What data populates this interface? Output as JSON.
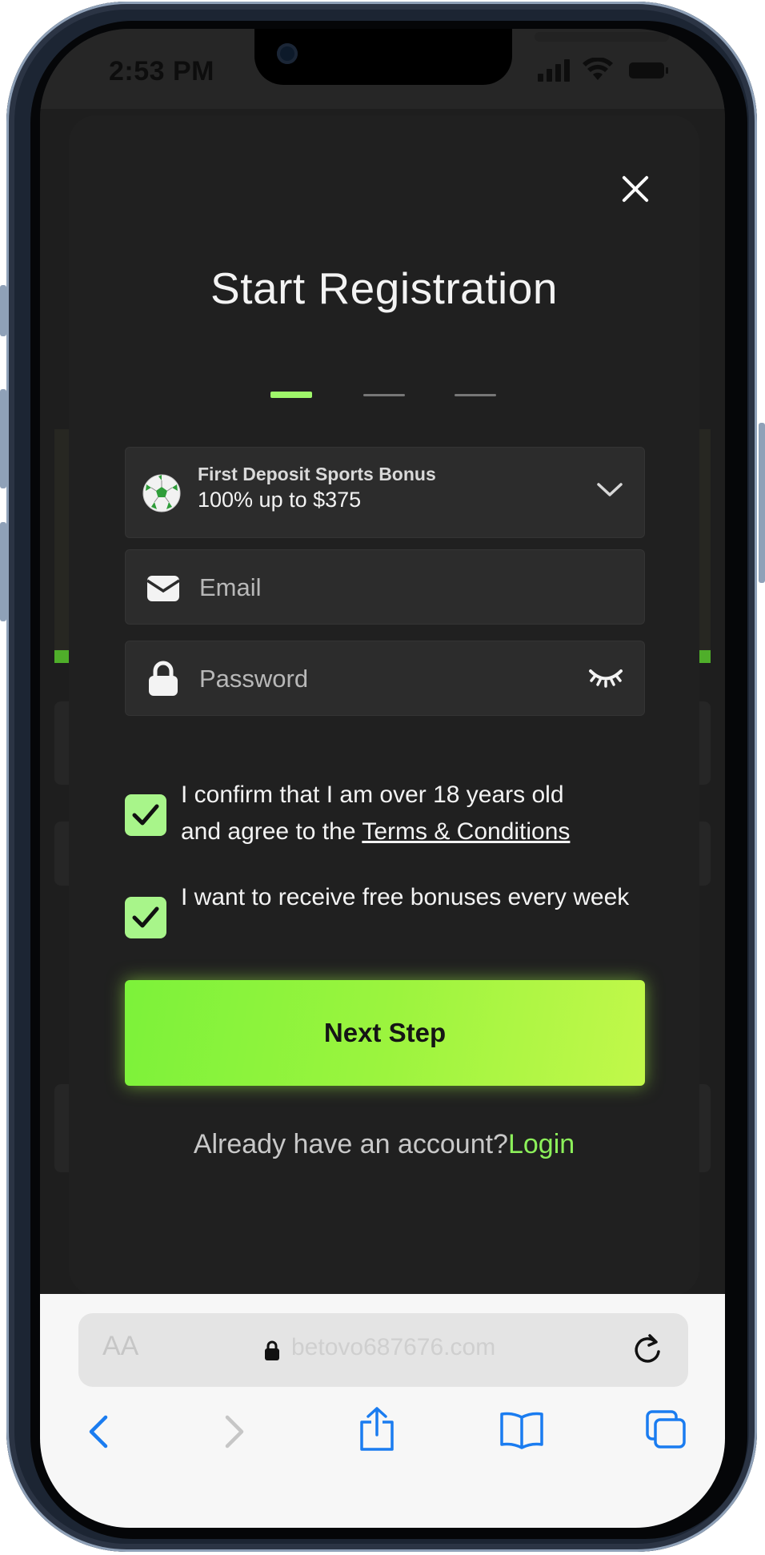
{
  "status_bar": {
    "time": "2:53 PM",
    "icons": [
      "cellular-signal-icon",
      "wifi-icon",
      "battery-icon"
    ]
  },
  "modal": {
    "title": "Start Registration",
    "close_icon": "close-icon",
    "steps": {
      "total": 3,
      "current": 1
    },
    "bonus": {
      "icon": "soccer-ball-icon",
      "title": "First Deposit Sports Bonus",
      "value": "100% up to $375"
    },
    "email": {
      "placeholder": "Email",
      "icon": "envelope-icon"
    },
    "password": {
      "placeholder": "Password",
      "icon": "lock-icon",
      "toggle_icon": "eye-closed-icon"
    },
    "consent_age": {
      "checked": true,
      "text_line1": "I confirm that I am over 18 years old",
      "text_prefix": "and agree to the ",
      "link": "Terms & Conditions"
    },
    "consent_bonus": {
      "checked": true,
      "text": "I want to receive free bonuses every week"
    },
    "next_button": "Next Step",
    "login_prompt": "Already have an account?",
    "login_link": "Login"
  },
  "browser": {
    "text_size_label": "AA",
    "url": "betovo687676.com",
    "toolbar": [
      "back-icon",
      "forward-icon",
      "share-icon",
      "bookmarks-icon",
      "tabs-icon"
    ]
  },
  "colors": {
    "accent_green": "#9ff76a",
    "button_green": "#9bf43e",
    "modal_bg": "#202020",
    "link_blue": "#1a7cf0"
  }
}
